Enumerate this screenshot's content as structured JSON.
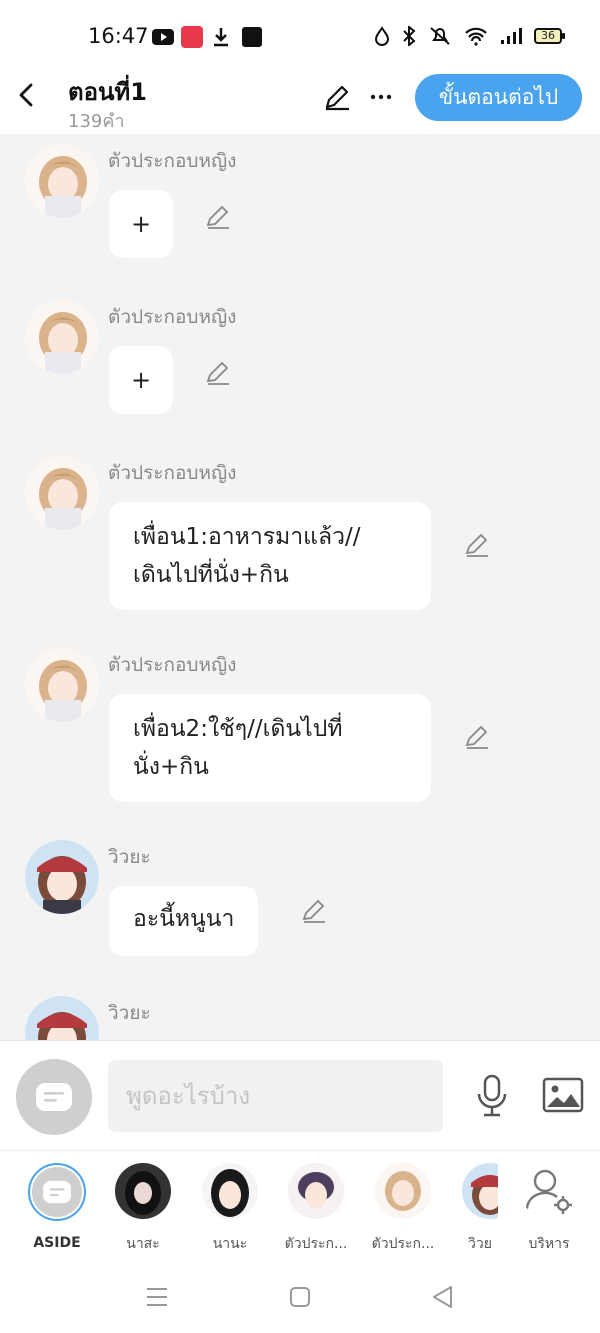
{
  "status_bar": {
    "time": "16:47",
    "battery": "36"
  },
  "header": {
    "title": "ตอนที่1",
    "word_count": "139คำ",
    "next_button": "ขั้นตอนต่อไป"
  },
  "messages": [
    {
      "sender": "ตัวประกอบหญิง",
      "text": "+",
      "avatar": "blonde-girl-avatar"
    },
    {
      "sender": "ตัวประกอบหญิง",
      "text": "+",
      "avatar": "blonde-girl-avatar"
    },
    {
      "sender": "ตัวประกอบหญิง",
      "text": "เพื่อน1:อาหารมาแล้ว//\nเดินไปที่นั่ง+กิน",
      "avatar": "blonde-girl-avatar"
    },
    {
      "sender": "ตัวประกอบหญิง",
      "text": "เพื่อน2:ใช้ๆ//เดินไปที่\nนั่ง+กิน",
      "avatar": "blonde-girl-avatar"
    },
    {
      "sender": "วิวยะ",
      "text": "อะนี้หนูนา",
      "avatar": "red-cap-girl-avatar"
    },
    {
      "sender": "วิวยะ",
      "text": "",
      "avatar": "red-cap-girl-avatar"
    }
  ],
  "input": {
    "placeholder": "พูดอะไรบ้าง"
  },
  "characters": [
    {
      "label": "ASIDE"
    },
    {
      "label": "นาสะ"
    },
    {
      "label": "นานะ"
    },
    {
      "label": "ตัวประก..."
    },
    {
      "label": "ตัวประก..."
    },
    {
      "label": "วิวย"
    },
    {
      "label": "บริหาร"
    }
  ],
  "colors": {
    "accent": "#4aa3ee",
    "background": "#f3f3f3"
  }
}
